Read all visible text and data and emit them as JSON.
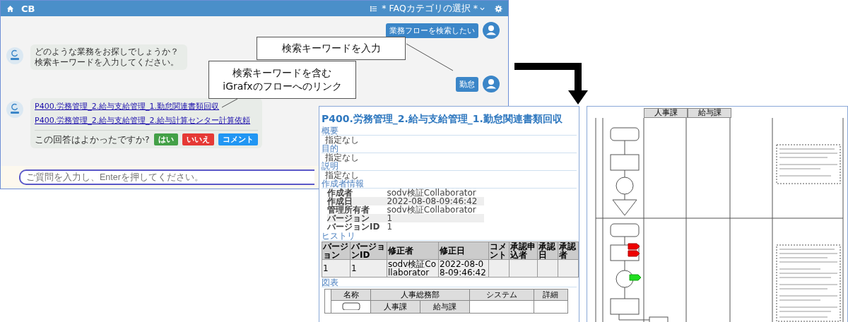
{
  "header": {
    "title": "CB",
    "category_select": "* FAQカテゴリの選択 *"
  },
  "messages": [
    {
      "kind": "user",
      "text": "業務フローを検索したい"
    },
    {
      "kind": "bot",
      "text": "どのような業務をお探しでしょうか？検索キーワードを入力してください。"
    },
    {
      "kind": "user",
      "text": "勤怠"
    },
    {
      "kind": "bot_links",
      "links": [
        "P400.労務管理_2.給与支給管理_1.勤怠関連書類回収",
        "P400.労務管理_2.給与支給管理_2.給与計算センター計算依頼"
      ],
      "question": "この回答はよかったですか?",
      "buttons": [
        {
          "label": "はい",
          "color": "#43a047"
        },
        {
          "label": "いいえ",
          "color": "#e53935"
        },
        {
          "label": "コメント",
          "color": "#2196f3"
        }
      ]
    }
  ],
  "input": {
    "placeholder": "ご質問を入力し、Enterを押してください。"
  },
  "callouts": [
    {
      "text": "検索キーワードを入力"
    },
    {
      "text": "検索キーワードを含む\niGrafxのフローへのリンク"
    }
  ],
  "document": {
    "title": "P400.労務管理_2.給与支給管理_1.勤怠関連書類回収",
    "sections": [
      {
        "heading": "概要",
        "body": "指定なし"
      },
      {
        "heading": "目的",
        "body": "指定なし"
      },
      {
        "heading": "説明",
        "body": "指定なし"
      }
    ],
    "author_heading": "作成者情報",
    "author_rows": [
      [
        "作成者",
        "sodv検証Collaborator"
      ],
      [
        "作成日",
        "2022-08-08-09:46:42"
      ],
      [
        "管理所有者",
        "sodv検証Collaborator"
      ],
      [
        "バージョン",
        "1"
      ],
      [
        "バージョンID",
        "1"
      ]
    ],
    "history_heading": "ヒストリ",
    "history_columns": [
      "バージョン",
      "バージョンID",
      "修正者",
      "修正日",
      "コメント",
      "承認申込者",
      "承認日",
      "承認者"
    ],
    "history_rows": [
      [
        "1",
        "1",
        "sodv検証Collaborator",
        "2022-08-08-09:46:42",
        "",
        "",
        "",
        ""
      ]
    ],
    "diagram_heading": "図表",
    "diagram_columns": [
      "名称",
      "人事総務部",
      "システム",
      "詳細"
    ],
    "diagram_sub_columns": [
      "人事課",
      "給与課"
    ]
  },
  "flow": {
    "sub_columns": [
      "人事課",
      "給与課"
    ]
  }
}
